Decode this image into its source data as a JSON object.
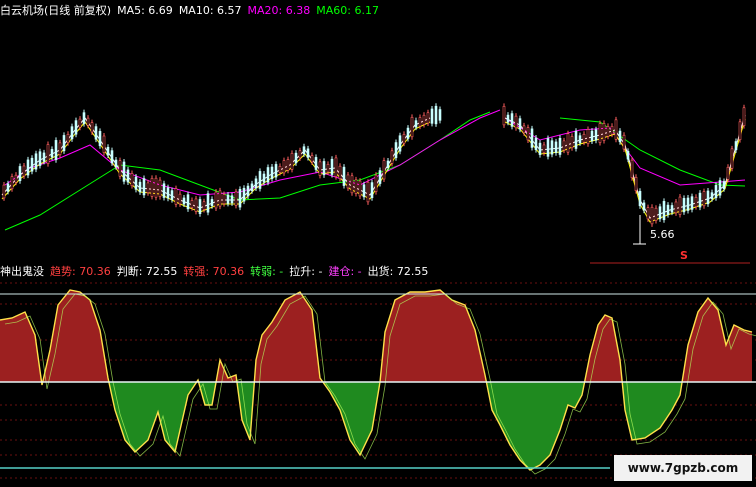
{
  "header": {
    "title": "白云机场(日线 前复权)",
    "ma5": "MA5: 6.69",
    "ma10": "MA10: 6.57",
    "ma20": "MA20: 6.38",
    "ma60": "MA60: 6.17"
  },
  "price_panel": {
    "low_label": "5.66",
    "marker": "S"
  },
  "indicator_bar": {
    "name": "神出鬼没",
    "trend": "趋势: 70.36",
    "judge": "判断: 72.55",
    "strong": "转强: 70.36",
    "weak": "转弱: -",
    "pull": "拉升: -",
    "hold": "建仓: -",
    "out": "出货: 72.55"
  },
  "watermark": "www.7gpzb.com",
  "colors": {
    "background": "#000000",
    "ma5": "#ffffff",
    "ma10": "#ffff00",
    "ma20": "#ff00ff",
    "ma60": "#00ff00",
    "red_fill": "#9c2020",
    "green_fill": "#1f8a1f",
    "yellow_line": "#ffe14a",
    "baseline": "#e8f4f4",
    "cyan_line": "#55d0c8",
    "red_dash": "#6a1010"
  }
}
